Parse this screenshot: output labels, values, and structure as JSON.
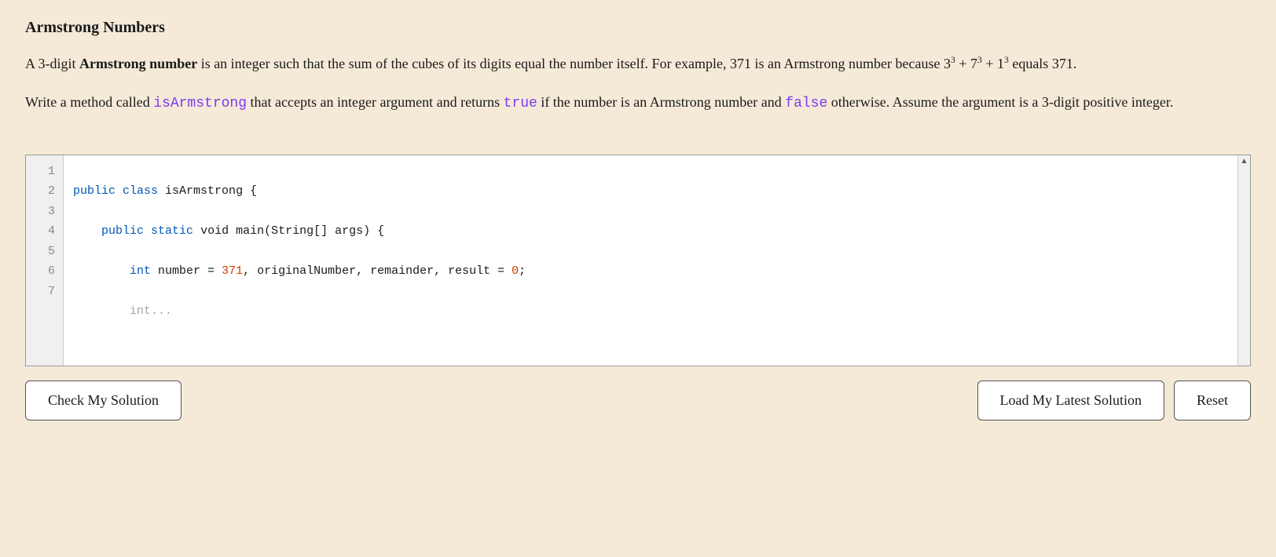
{
  "page": {
    "title": "Armstrong Numbers",
    "description1": "A 3-digit Armstrong number is an integer such that the sum of the cubes of its digits equal the number itself. For example, 371 is an Armstrong number because 3",
    "desc1_exp1": "3",
    "desc1_mid": " + 7",
    "desc1_exp2": "3",
    "desc1_mid2": " + 1",
    "desc1_exp3": "3",
    "desc1_end": " equals 371.",
    "description2_pre": "Write a method called ",
    "description2_method": "isArmstrong",
    "description2_mid": " that accepts an integer argument and returns ",
    "description2_true": "true",
    "description2_mid2": " if the number is an Armstrong number and ",
    "description2_false": "false",
    "description2_end": " otherwise. Assume the argument is a 3-digit positive integer."
  },
  "editor": {
    "lines": [
      {
        "num": "1",
        "code": "public class isArmstrong {"
      },
      {
        "num": "2",
        "code": ""
      },
      {
        "num": "3",
        "code": "    public static void main(String[] args) {"
      },
      {
        "num": "4",
        "code": ""
      },
      {
        "num": "5",
        "code": "        int number = 371, originalNumber, remainder, result = 0;"
      },
      {
        "num": "6",
        "code": ""
      },
      {
        "num": "7",
        "code": "        int..."
      }
    ]
  },
  "buttons": {
    "check": "Check My Solution",
    "load": "Load My Latest Solution",
    "reset": "Reset"
  }
}
